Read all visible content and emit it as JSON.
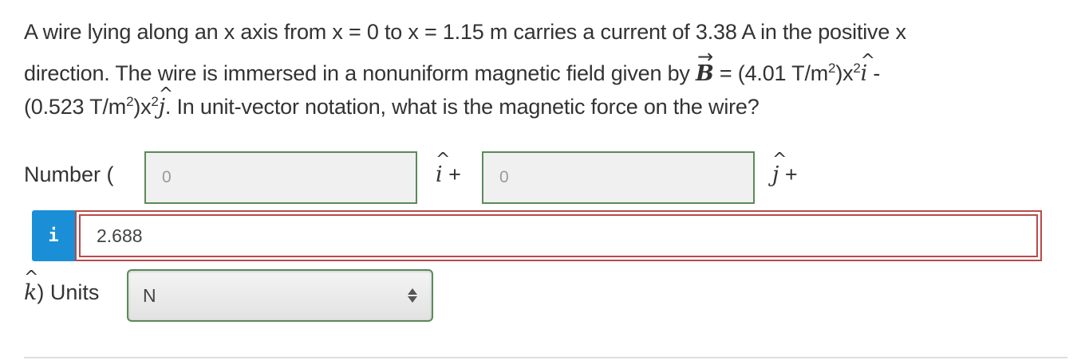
{
  "question": {
    "line1": "A wire lying along an x axis from x = 0 to x = 1.15 m carries a current of 3.38 A in the positive x",
    "line2_before_vec": "direction. The wire is immersed in a nonuniform magnetic field given by ",
    "vec_symbol": "B",
    "vec_arrow": "→",
    "line2_after_vec": " = (4.01 T/m",
    "line2_exp1": "2",
    "line2_mid": ")x",
    "line2_exp2": "2",
    "unit_i": "i",
    "hat_symbol": "^",
    "line2_tail": " -",
    "line3_start": "(0.523 T/m",
    "line3_exp1": "2",
    "line3_mid": ")x",
    "line3_exp2": "2",
    "unit_j": "j",
    "line3_end": ". In unit-vector notation, what is the magnetic force on the wire?"
  },
  "answer": {
    "number_label": "Number (",
    "i_component": "0",
    "i_label_symbol": "i",
    "plus": "+",
    "j_component": "0",
    "j_label_symbol": "j",
    "info_icon_glyph": "i",
    "k_component": "2.688",
    "k_label_symbol": "k",
    "units_label": ") Units",
    "units_value": "N"
  },
  "colors": {
    "input_border": "#5a8a5a",
    "error_border": "#b84a4a",
    "info_button": "#1a8fd8",
    "text": "#333333"
  }
}
